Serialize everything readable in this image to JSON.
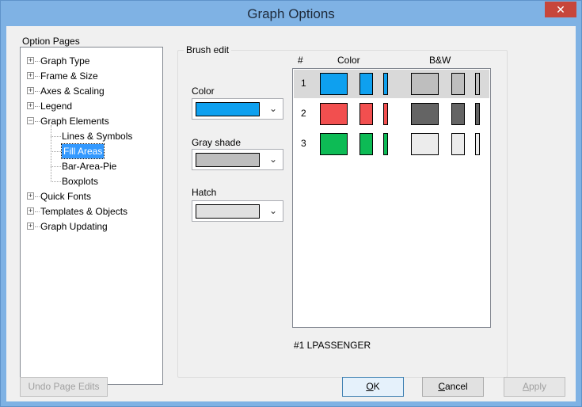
{
  "window": {
    "title": "Graph Options",
    "close_glyph": "✕"
  },
  "tree": {
    "caption": "Option Pages",
    "items": [
      {
        "label": "Graph Type",
        "level": 0,
        "expander": "+"
      },
      {
        "label": "Frame & Size",
        "level": 0,
        "expander": "+"
      },
      {
        "label": "Axes & Scaling",
        "level": 0,
        "expander": "+"
      },
      {
        "label": "Legend",
        "level": 0,
        "expander": "+"
      },
      {
        "label": "Graph Elements",
        "level": 0,
        "expander": "−"
      },
      {
        "label": "Lines & Symbols",
        "level": 1
      },
      {
        "label": "Fill Areas",
        "level": 1,
        "selected": true
      },
      {
        "label": "Bar-Area-Pie",
        "level": 1
      },
      {
        "label": "Boxplots",
        "level": 1
      },
      {
        "label": "Quick Fonts",
        "level": 0,
        "expander": "+"
      },
      {
        "label": "Templates & Objects",
        "level": 0,
        "expander": "+"
      },
      {
        "label": "Graph Updating",
        "level": 0,
        "expander": "+"
      }
    ]
  },
  "brush_edit": {
    "caption": "Brush edit",
    "color_label": "Color",
    "color_value": "#0ea0ef",
    "gray_label": "Gray shade",
    "gray_value": "#bebebe",
    "hatch_label": "Hatch",
    "hatch_value": "#e0e0e0",
    "dropdown_glyph": "⌄"
  },
  "brush_list": {
    "headers": {
      "num": "#",
      "color": "Color",
      "bw": "B&W"
    },
    "rows": [
      {
        "num": "1",
        "color": "#0ea0ef",
        "bw": "#bebebe",
        "selected": true
      },
      {
        "num": "2",
        "color": "#f24f4f",
        "bw": "#646464",
        "selected": false
      },
      {
        "num": "3",
        "color": "#0dbb55",
        "bw": "#ececec",
        "selected": false
      }
    ],
    "status": "#1 LPASSENGER"
  },
  "buttons": {
    "undo": "Undo Page Edits",
    "ok_mnemonic": "O",
    "ok_rest": "K",
    "cancel_mnemonic": "C",
    "cancel_rest": "ancel",
    "apply_mnemonic": "A",
    "apply_rest": "pply"
  }
}
